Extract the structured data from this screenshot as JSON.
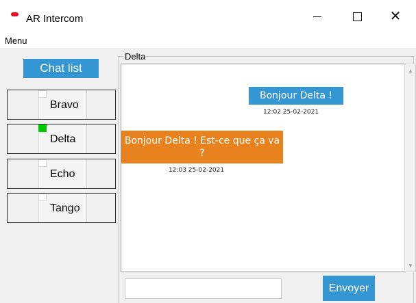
{
  "window": {
    "title": "AR Intercom",
    "controls": {
      "minimize_icon": "minimize-icon",
      "maximize_icon": "maximize-icon",
      "close_glyph": "✕"
    }
  },
  "menu": {
    "label": "Menu"
  },
  "sidebar": {
    "chat_list_label": "Chat list",
    "contacts": [
      {
        "name": "Bravo",
        "online": false
      },
      {
        "name": "Delta",
        "online": true
      },
      {
        "name": "Echo",
        "online": false
      },
      {
        "name": "Tango",
        "online": false
      }
    ]
  },
  "chat": {
    "title": "Delta",
    "messages": [
      {
        "direction": "outgoing",
        "text": "Bonjour Delta !",
        "timestamp": "12:02  25-02-2021"
      },
      {
        "direction": "incoming",
        "text": "Bonjour Delta ! Est-ce que ça va ?",
        "timestamp": "12:03  25-02-2021"
      }
    ],
    "input_value": "",
    "send_label": "Envoyer"
  },
  "colors": {
    "accent_blue": "#3596d4",
    "incoming_orange": "#e8821e",
    "online_green": "#00c800",
    "app_icon_red": "#e81123"
  }
}
